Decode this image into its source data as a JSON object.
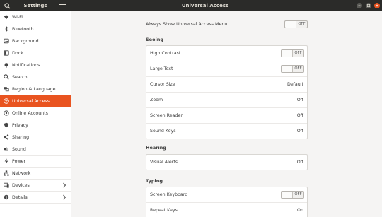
{
  "titlebar": {
    "left_title": "Settings",
    "main_title": "Universal Access"
  },
  "sidebar": {
    "items": [
      {
        "label": "Wi-Fi",
        "icon": "wifi-icon"
      },
      {
        "label": "Bluetooth",
        "icon": "bluetooth-icon"
      },
      {
        "label": "Background",
        "icon": "background-icon"
      },
      {
        "label": "Dock",
        "icon": "dock-icon"
      },
      {
        "label": "Notifications",
        "icon": "bell-icon"
      },
      {
        "label": "Search",
        "icon": "search-icon"
      },
      {
        "label": "Region & Language",
        "icon": "region-icon"
      },
      {
        "label": "Universal Access",
        "icon": "universal-access-icon",
        "active": true
      },
      {
        "label": "Online Accounts",
        "icon": "online-accounts-icon"
      },
      {
        "label": "Privacy",
        "icon": "privacy-icon"
      },
      {
        "label": "Sharing",
        "icon": "sharing-icon"
      },
      {
        "label": "Sound",
        "icon": "sound-icon"
      },
      {
        "label": "Power",
        "icon": "power-icon"
      },
      {
        "label": "Network",
        "icon": "network-icon"
      },
      {
        "label": "Devices",
        "icon": "devices-icon",
        "chevron": true
      },
      {
        "label": "Details",
        "icon": "details-icon",
        "chevron": true
      }
    ]
  },
  "main": {
    "always_show": {
      "label": "Always Show Universal Access Menu",
      "toggle": "OFF"
    },
    "seeing": {
      "heading": "Seeing",
      "rows": [
        {
          "label": "High Contrast",
          "toggle": "OFF"
        },
        {
          "label": "Large Text",
          "toggle": "OFF"
        },
        {
          "label": "Cursor Size",
          "value": "Default"
        },
        {
          "label": "Zoom",
          "value": "Off"
        },
        {
          "label": "Screen Reader",
          "value": "Off"
        },
        {
          "label": "Sound Keys",
          "value": "Off"
        }
      ]
    },
    "hearing": {
      "heading": "Hearing",
      "rows": [
        {
          "label": "Visual Alerts",
          "value": "Off"
        }
      ]
    },
    "typing": {
      "heading": "Typing",
      "rows": [
        {
          "label": "Screen Keyboard",
          "toggle": "OFF"
        },
        {
          "label": "Repeat Keys",
          "value": "On"
        }
      ]
    }
  },
  "colors": {
    "accent": "#e95420",
    "titlebar": "#2b2b29"
  }
}
